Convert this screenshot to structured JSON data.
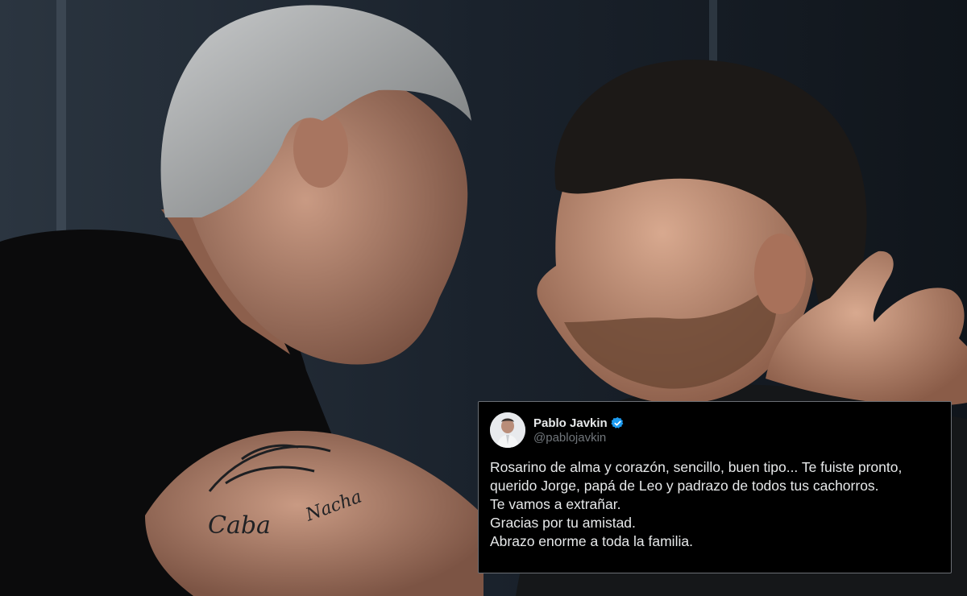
{
  "photo": {
    "description_icon": "photo-two-men-embracing",
    "tattoo_text": [
      "Caba",
      "Nacha"
    ]
  },
  "tweet": {
    "display_name": "Pablo Javkin",
    "handle": "@pablojavkin",
    "verified_icon": "verified-badge-icon",
    "verified_color": "#1d9bf0",
    "lines": [
      "Rosarino de alma y corazón, sencillo, buen tipo... Te fuiste pronto,",
      "querido Jorge, papá de Leo y padrazo de todos tus cachorros.",
      "Te vamos a extrañar.",
      "Gracias por tu amistad.",
      "Abrazo enorme a toda la familia."
    ]
  }
}
